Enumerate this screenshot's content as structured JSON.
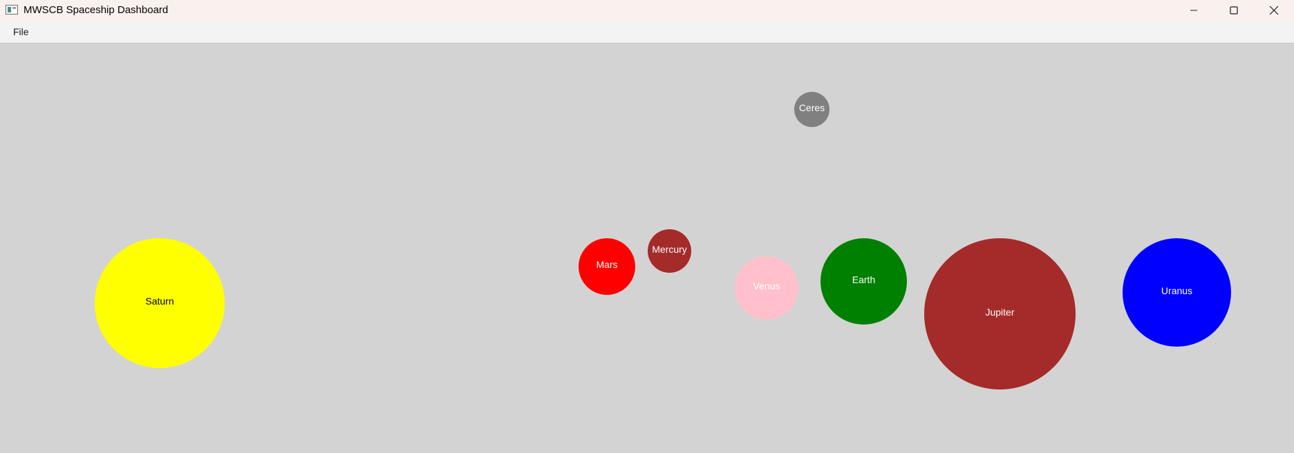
{
  "window": {
    "title": "MWSCB Spaceship Dashboard",
    "icons": {
      "app": "app-window-icon",
      "minimize": "minimize-icon",
      "maximize": "maximize-icon",
      "close": "close-icon"
    }
  },
  "menubar": {
    "items": [
      {
        "label": "File"
      }
    ]
  },
  "canvas": {
    "background": "#d3d3d3",
    "planets": [
      {
        "name": "Saturn",
        "color": "#ffff00",
        "label_color": "#000000"
      },
      {
        "name": "Mars",
        "color": "#ff0000",
        "label_color": "#ffffff"
      },
      {
        "name": "Mercury",
        "color": "#a52a2a",
        "label_color": "#ffffff"
      },
      {
        "name": "Venus",
        "color": "#ffc0cb",
        "label_color": "#ffffff"
      },
      {
        "name": "Earth",
        "color": "#008000",
        "label_color": "#ffffff"
      },
      {
        "name": "Jupiter",
        "color": "#a52a2a",
        "label_color": "#ffffff"
      },
      {
        "name": "Uranus",
        "color": "#0000ff",
        "label_color": "#ffffff"
      },
      {
        "name": "Ceres",
        "color": "#808080",
        "label_color": "#ffffff"
      }
    ]
  }
}
